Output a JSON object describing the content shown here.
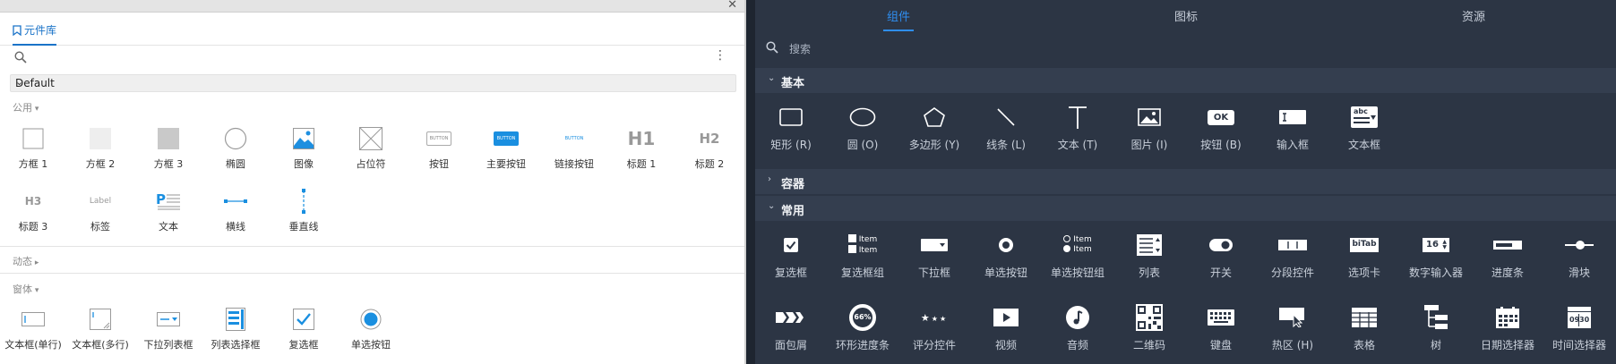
{
  "left": {
    "tab_label": "元件库",
    "library_select": "Default",
    "sections": {
      "common": "公用",
      "dynamic": "动态",
      "form": "窗体"
    },
    "common_items": [
      "方框 1",
      "方框 2",
      "方框 3",
      "椭圆",
      "图像",
      "占位符",
      "按钮",
      "主要按钮",
      "链接按钮",
      "标题 1",
      "标题 2",
      "标题 3",
      "标签",
      "文本",
      "横线",
      "垂直线"
    ],
    "form_items": [
      "文本框(单行)",
      "文本框(多行)",
      "下拉列表框",
      "列表选择框",
      "复选框",
      "单选按钮"
    ],
    "icon_text": {
      "button": "BUTTON",
      "h1": "H1",
      "h2": "H2",
      "h3": "H3",
      "label": "Label",
      "text_p": "P"
    }
  },
  "right": {
    "tabs": [
      "组件",
      "图标",
      "资源"
    ],
    "search_placeholder": "搜索",
    "sections": {
      "basic": "基本",
      "container": "容器",
      "common": "常用"
    },
    "basic_items": [
      "矩形 (R)",
      "圆 (O)",
      "多边形 (Y)",
      "线条 (L)",
      "文本 (T)",
      "图片 (I)",
      "按钮 (B)",
      "输入框",
      "文本框"
    ],
    "common_row1": [
      "复选框",
      "复选框组",
      "下拉框",
      "单选按钮",
      "单选按钮组",
      "列表",
      "开关",
      "分段控件",
      "选项卡",
      "数字输入器",
      "进度条",
      "滑块"
    ],
    "common_row2": [
      "面包屑",
      "环形进度条",
      "评分控件",
      "视频",
      "音频",
      "二维码",
      "键盘",
      "热区 (H)",
      "表格",
      "树",
      "日期选择器",
      "时间选择器"
    ],
    "icon_text": {
      "ok": "OK",
      "abc": "abc",
      "item": "Item",
      "bitab": "biTab",
      "num": "16",
      "ring": "66%",
      "date": "09",
      "time": "30"
    }
  }
}
